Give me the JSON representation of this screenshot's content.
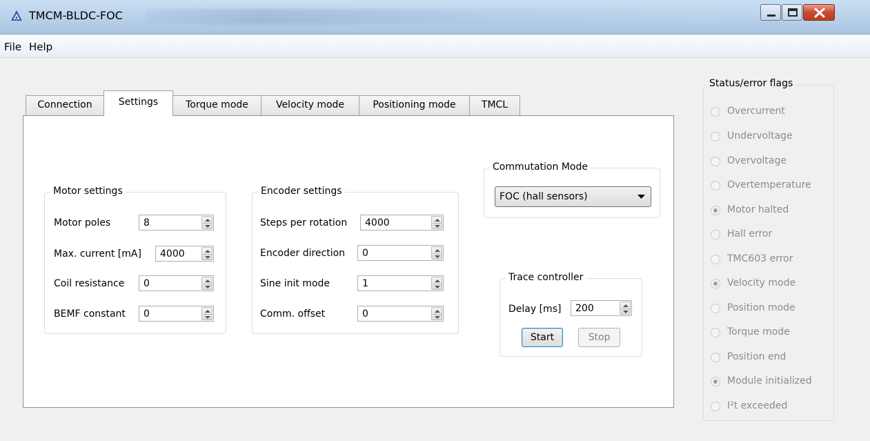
{
  "window": {
    "title": "TMCM-BLDC-FOC"
  },
  "menu": [
    {
      "label": "File"
    },
    {
      "label": "Help"
    }
  ],
  "tabs": [
    {
      "label": "Connection",
      "active": false
    },
    {
      "label": "Settings",
      "active": true
    },
    {
      "label": "Torque mode",
      "active": false
    },
    {
      "label": "Velocity mode",
      "active": false
    },
    {
      "label": "Positioning mode",
      "active": false
    },
    {
      "label": "TMCL",
      "active": false
    }
  ],
  "motor_settings": {
    "title": "Motor settings",
    "fields": [
      {
        "label": "Motor poles",
        "value": "8"
      },
      {
        "label": "Max. current [mA]",
        "value": "4000"
      },
      {
        "label": "Coil resistance",
        "value": "0"
      },
      {
        "label": "BEMF constant",
        "value": "0"
      }
    ]
  },
  "encoder_settings": {
    "title": "Encoder settings",
    "fields": [
      {
        "label": "Steps per rotation",
        "value": "4000"
      },
      {
        "label": "Encoder direction",
        "value": "0"
      },
      {
        "label": "Sine init mode",
        "value": "1"
      },
      {
        "label": "Comm. offset",
        "value": "0"
      }
    ]
  },
  "commutation": {
    "title": "Commutation Mode",
    "selected": "FOC (hall sensors)"
  },
  "trace": {
    "title": "Trace controller",
    "delay_label": "Delay [ms]",
    "delay_value": "200",
    "start_label": "Start",
    "stop_label": "Stop"
  },
  "status": {
    "title": "Status/error flags",
    "flags": [
      {
        "label": "Overcurrent",
        "checked": false
      },
      {
        "label": "Undervoltage",
        "checked": false
      },
      {
        "label": "Overvoltage",
        "checked": false
      },
      {
        "label": "Overtemperature",
        "checked": false
      },
      {
        "label": "Motor halted",
        "checked": true
      },
      {
        "label": "Hall error",
        "checked": false
      },
      {
        "label": "TMC603 error",
        "checked": false
      },
      {
        "label": "Velocity mode",
        "checked": true
      },
      {
        "label": "Position mode",
        "checked": false
      },
      {
        "label": "Torque mode",
        "checked": false
      },
      {
        "label": "Position end",
        "checked": false
      },
      {
        "label": "Module initialized",
        "checked": true
      },
      {
        "label": "I²t exceeded",
        "checked": false
      }
    ]
  },
  "colors": {
    "titlebar": "#b7d0e9",
    "close_button": "#c84a2e",
    "window_bg": "#f0f0f0"
  }
}
